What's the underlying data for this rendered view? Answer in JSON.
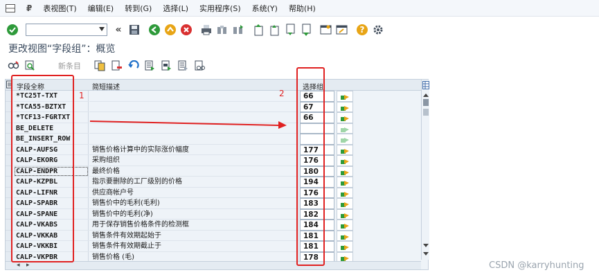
{
  "menu": {
    "items": [
      "表视图(T)",
      "编辑(E)",
      "转到(G)",
      "选择(L)",
      "实用程序(S)",
      "系统(Y)",
      "帮助(H)"
    ]
  },
  "screen": {
    "title": "更改视图“字段组”：概览",
    "new_entries_label": "新条目"
  },
  "table": {
    "headers": {
      "field_name": "字段全称",
      "description": "简短描述",
      "group": "选择组"
    },
    "rows": [
      {
        "name": "*TC25T-TXT",
        "desc": "",
        "group": "66",
        "active": true
      },
      {
        "name": "*TCA55-BZTXT",
        "desc": "",
        "group": "67",
        "active": true
      },
      {
        "name": "*TCF13-FGRTXT",
        "desc": "",
        "group": "66",
        "active": true
      },
      {
        "name": "BE_DELETE",
        "desc": "",
        "group": "",
        "active": false
      },
      {
        "name": "BE_INSERT_ROW",
        "desc": "",
        "group": "",
        "active": false
      },
      {
        "name": "CALP-AUFSG",
        "desc": "销售价格计算中的实际涨价幅度",
        "group": "177",
        "active": true
      },
      {
        "name": "CALP-EKORG",
        "desc": "采购组织",
        "group": "176",
        "active": true
      },
      {
        "name": "CALP-ENDPR",
        "desc": "最终价格",
        "group": "180",
        "active": true
      },
      {
        "name": "CALP-KZPBL",
        "desc": "指示要删除的工厂级别的价格",
        "group": "194",
        "active": true
      },
      {
        "name": "CALP-LIFNR",
        "desc": "供应商帐户号",
        "group": "176",
        "active": true
      },
      {
        "name": "CALP-SPABR",
        "desc": "销售价中的毛利(毛利)",
        "group": "183",
        "active": true
      },
      {
        "name": "CALP-SPANE",
        "desc": "销售价中的毛利(净)",
        "group": "182",
        "active": true
      },
      {
        "name": "CALP-VKABS",
        "desc": "用于保存销售价格条件的检测框",
        "group": "184",
        "active": true
      },
      {
        "name": "CALP-VKKAB",
        "desc": "销售条件有效期起始于",
        "group": "181",
        "active": true
      },
      {
        "name": "CALP-VKKBI",
        "desc": "销售条件有效期截止于",
        "group": "181",
        "active": true
      },
      {
        "name": "CALP-VKPBR",
        "desc": "销售价格 (毛)",
        "group": "178",
        "active": true
      }
    ]
  },
  "annotations": {
    "label_1": "1",
    "label_2": "2",
    "color": "#e02020"
  },
  "watermark": "CSDN @karryhunting"
}
